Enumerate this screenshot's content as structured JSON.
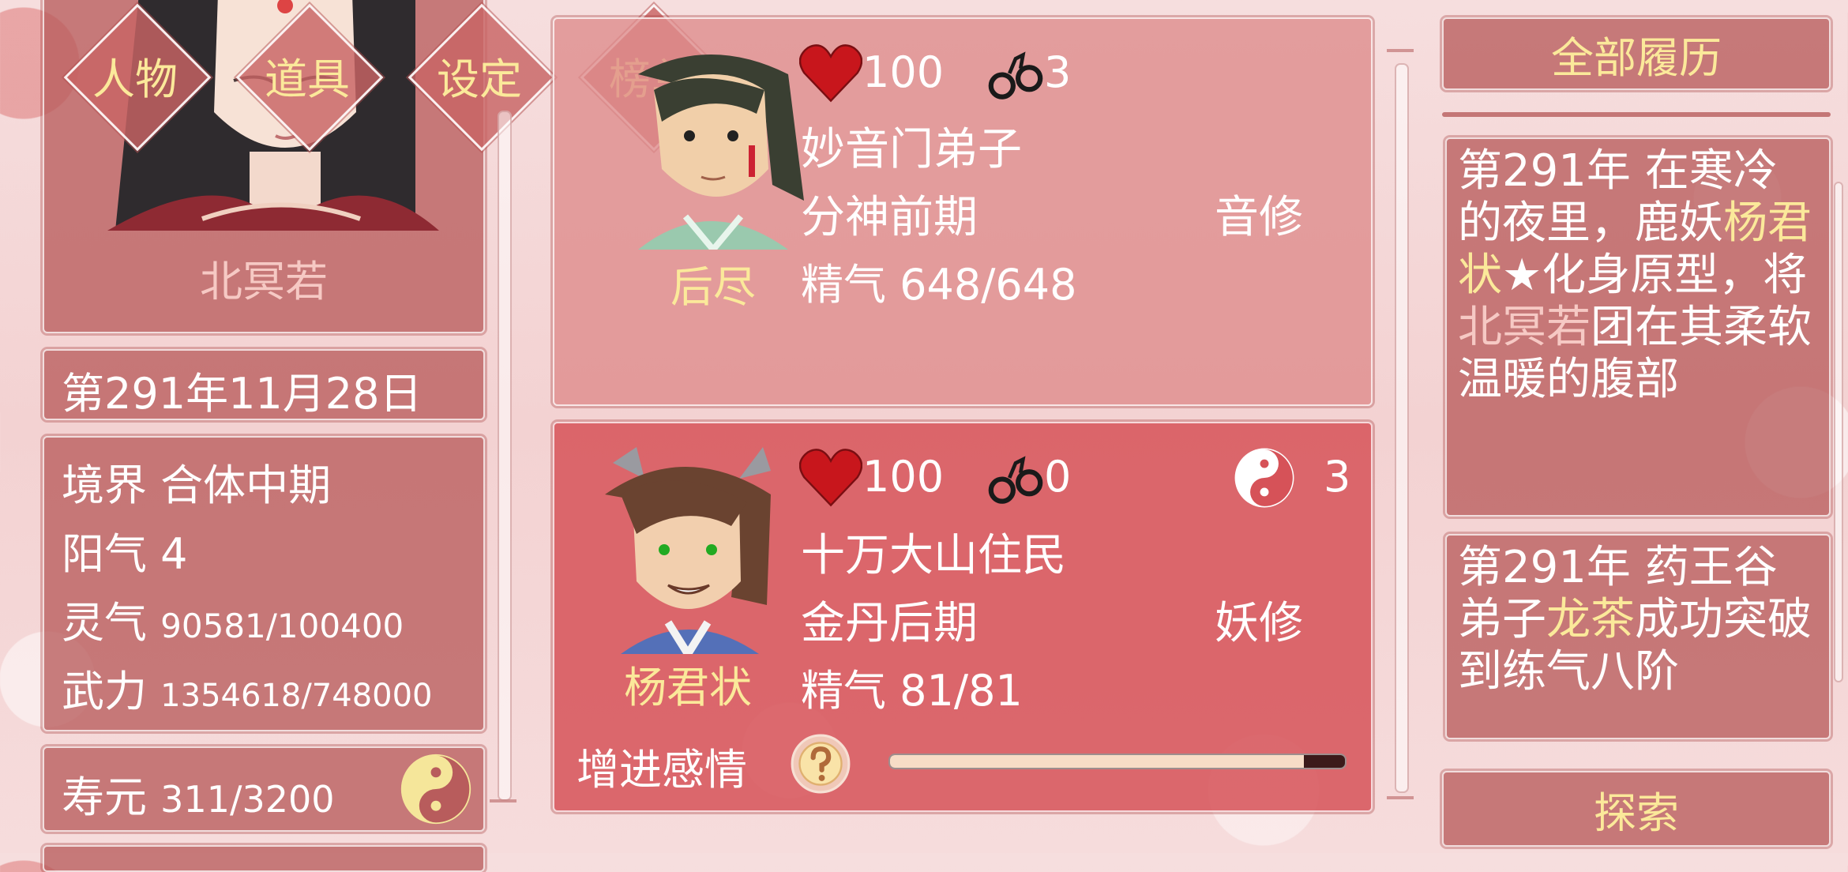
{
  "nav_tabs": [
    {
      "label": "人物"
    },
    {
      "label": "道具"
    },
    {
      "label": "设定"
    },
    {
      "label": "榜单"
    }
  ],
  "player": {
    "name": "北冥若",
    "date": "第291年11月28日",
    "stats": {
      "realm_label": "境界",
      "realm_value": "合体中期",
      "yang_label": "阳气",
      "yang_value": "4",
      "qi_label": "灵气",
      "qi_value": "90581/100400",
      "force_label": "武力",
      "force_value": "1354618/748000",
      "life_label": "寿元",
      "life_value": "311/3200"
    }
  },
  "cards": [
    {
      "name": "后尽",
      "hp": "100",
      "shackles": "3",
      "affiliation": "妙音门弟子",
      "realm": "分神前期",
      "cultivation_type": "音修",
      "essence_label": "精气",
      "essence_value": "648/648"
    },
    {
      "name": "杨君状",
      "hp": "100",
      "shackles": "0",
      "yinyang_count": "3",
      "affiliation": "十万大山住民",
      "realm": "金丹后期",
      "cultivation_type": "妖修",
      "essence_label": "精气",
      "essence_value": "81/81",
      "action_label": "增进感情",
      "affection_progress": 0.91
    }
  ],
  "history": {
    "button_label": "全部履历",
    "logs": [
      {
        "pre": "第291年 在寒冷的夜里，鹿妖",
        "hl1": "杨君状",
        "star": "★",
        "mid": "化身原型，将",
        "hl2": "北冥若",
        "post": "团在其柔软温暖的腹部"
      },
      {
        "pre": "第291年 药王谷弟子",
        "hl1": "龙茶",
        "post": "成功突破到练气八阶"
      }
    ],
    "explore_label": "探索"
  },
  "icons": {
    "heart": "heart-icon",
    "shackles": "handcuffs-icon",
    "yinyang": "yin-yang-icon",
    "help": "question-icon"
  },
  "colors": {
    "gold_text": "#fbe99a",
    "heart_red": "#c8161c",
    "card_active": "#d65258"
  }
}
